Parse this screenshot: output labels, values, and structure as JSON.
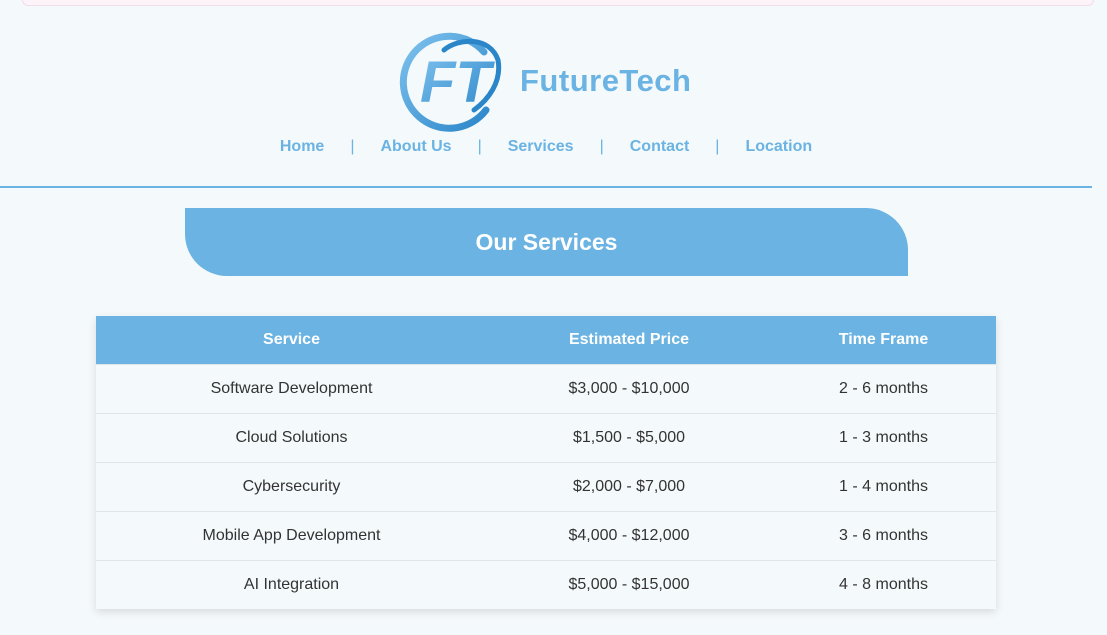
{
  "brand": {
    "logo_text": "FT",
    "name": "FutureTech"
  },
  "nav": {
    "items": [
      "Home",
      "About Us",
      "Services",
      "Contact",
      "Location"
    ],
    "separator": "|"
  },
  "section": {
    "title": "Our Services"
  },
  "colors": {
    "accent": "#6ab3e2",
    "background": "#f4f9fb",
    "text": "#333333"
  },
  "table": {
    "headers": [
      "Service",
      "Estimated Price",
      "Time Frame"
    ],
    "rows": [
      [
        "Software Development",
        "$3,000 - $10,000",
        "2 - 6 months"
      ],
      [
        "Cloud Solutions",
        "$1,500 - $5,000",
        "1 - 3 months"
      ],
      [
        "Cybersecurity",
        "$2,000 - $7,000",
        "1 - 4 months"
      ],
      [
        "Mobile App Development",
        "$4,000 - $12,000",
        "3 - 6 months"
      ],
      [
        "AI Integration",
        "$5,000 - $15,000",
        "4 - 8 months"
      ]
    ]
  }
}
